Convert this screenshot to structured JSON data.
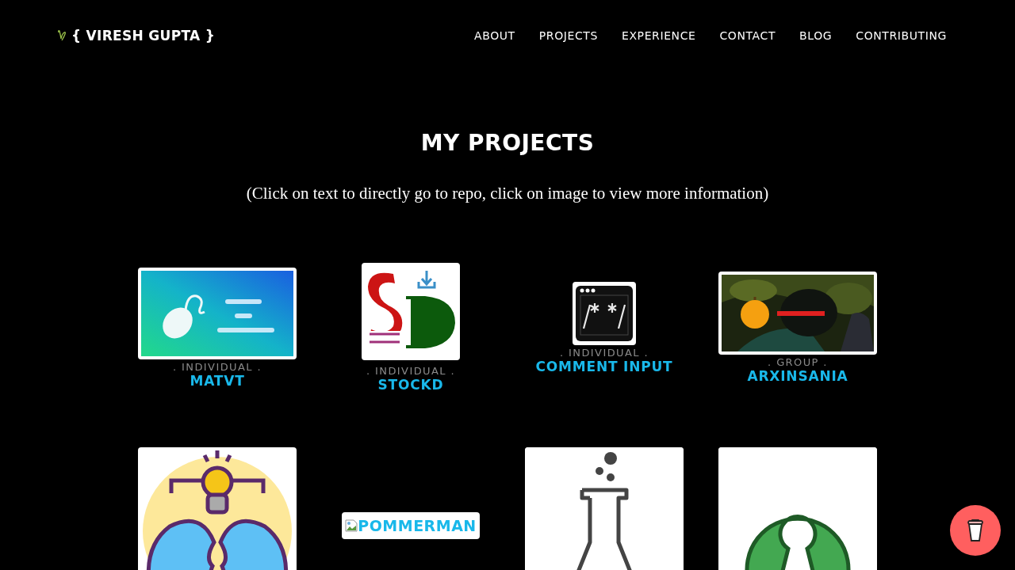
{
  "brand": {
    "name": "{ VIRESH GUPTA }"
  },
  "nav": [
    {
      "label": "ABOUT"
    },
    {
      "label": "PROJECTS"
    },
    {
      "label": "EXPERIENCE"
    },
    {
      "label": "CONTACT"
    },
    {
      "label": "BLOG"
    },
    {
      "label": "CONTRIBUTING"
    }
  ],
  "heading": "MY PROJECTS",
  "subtitle": "(Click on text to directly go to repo, click on image to view more information)",
  "projects": [
    {
      "kind": "mouse",
      "category": ". INDIVIDUAL .",
      "title": "MATVT"
    },
    {
      "kind": "stock",
      "category": ". INDIVIDUAL .",
      "title": "STOCKD"
    },
    {
      "kind": "code",
      "category": ". INDIVIDUAL .",
      "title": "COMMENT INPUT"
    },
    {
      "kind": "game",
      "category": ". GROUP .",
      "title": "ARXINSANIA"
    },
    {
      "kind": "idea"
    },
    {
      "kind": "broken",
      "alt": "POMMERMAN"
    },
    {
      "kind": "flask"
    },
    {
      "kind": "opensource"
    }
  ]
}
